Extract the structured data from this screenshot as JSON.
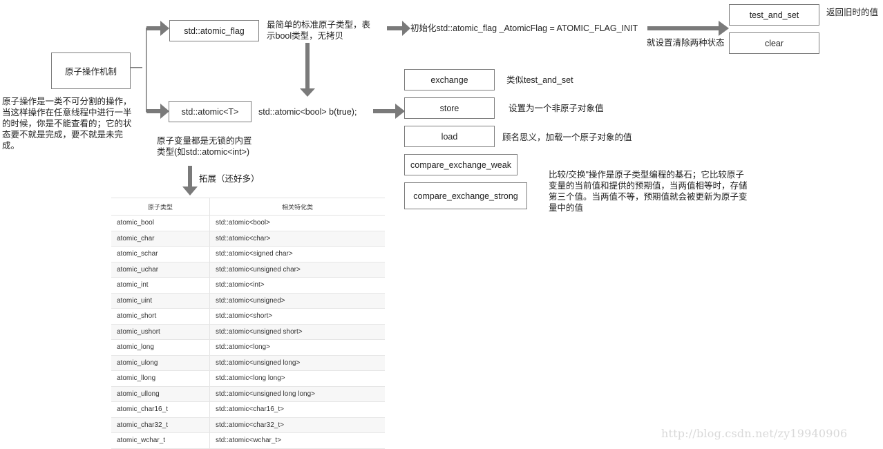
{
  "root": {
    "title": "原子操作机制",
    "description": "原子操作是一类不可分割的操作，\n当这样操作在任意线程中进行一半\n的时候，你是不能查看的；它的状\n态要不就是完成，要不就是未完\n成。"
  },
  "atomic_flag": {
    "label": "std::atomic_flag",
    "note": "最简单的标准原子类型，表\n示bool类型，无拷贝",
    "init": "初始化std::atomic_flag _AtomicFlag = ATOMIC_FLAG_INIT",
    "init_note": "就设置清除两种状态",
    "ops": [
      {
        "label": "test_and_set",
        "note": "返回旧时的值"
      },
      {
        "label": "clear",
        "note": ""
      }
    ]
  },
  "atomic_t": {
    "label": "std::atomic<T>",
    "example": "std::atomic<bool> b(true);",
    "note": "原子变量都是无锁的内置\n类型(如std::atomic<int>)",
    "extend_label": "拓展（还好多）",
    "ops": [
      {
        "label": "exchange",
        "note": "类似test_and_set"
      },
      {
        "label": "store",
        "note": "设置为一个非原子对象值"
      },
      {
        "label": "load",
        "note": "顾名思义，加载一个原子对象的值"
      },
      {
        "label": "compare_exchange_weak",
        "note": ""
      },
      {
        "label": "compare_exchange_strong",
        "note": ""
      }
    ],
    "cas_note": "比较/交换\"操作是原子类型编程的基石；它比较原子\n变量的当前值和提供的预期值，当两值相等时，存储\n第三个值。当两值不等，预期值就会被更新为原子变\n量中的值"
  },
  "table": {
    "headers": [
      "原子类型",
      "相关特化类"
    ],
    "rows": [
      [
        "atomic_bool",
        "std::atomic<bool>"
      ],
      [
        "atomic_char",
        "std::atomic<char>"
      ],
      [
        "atomic_schar",
        "std::atomic<signed char>"
      ],
      [
        "atomic_uchar",
        "std::atomic<unsigned char>"
      ],
      [
        "atomic_int",
        "std::atomic<int>"
      ],
      [
        "atomic_uint",
        "std::atomic<unsigned>"
      ],
      [
        "atomic_short",
        "std::atomic<short>"
      ],
      [
        "atomic_ushort",
        "std::atomic<unsigned short>"
      ],
      [
        "atomic_long",
        "std::atomic<long>"
      ],
      [
        "atomic_ulong",
        "std::atomic<unsigned long>"
      ],
      [
        "atomic_llong",
        "std::atomic<long long>"
      ],
      [
        "atomic_ullong",
        "std::atomic<unsigned long long>"
      ],
      [
        "atomic_char16_t",
        "std::atomic<char16_t>"
      ],
      [
        "atomic_char32_t",
        "std::atomic<char32_t>"
      ],
      [
        "atomic_wchar_t",
        "std::atomic<wchar_t>"
      ]
    ]
  },
  "watermark": "http://blog.csdn.net/zy19940906",
  "colors": {
    "arrow": "#7a7a7a",
    "border": "#7b7b7b"
  }
}
